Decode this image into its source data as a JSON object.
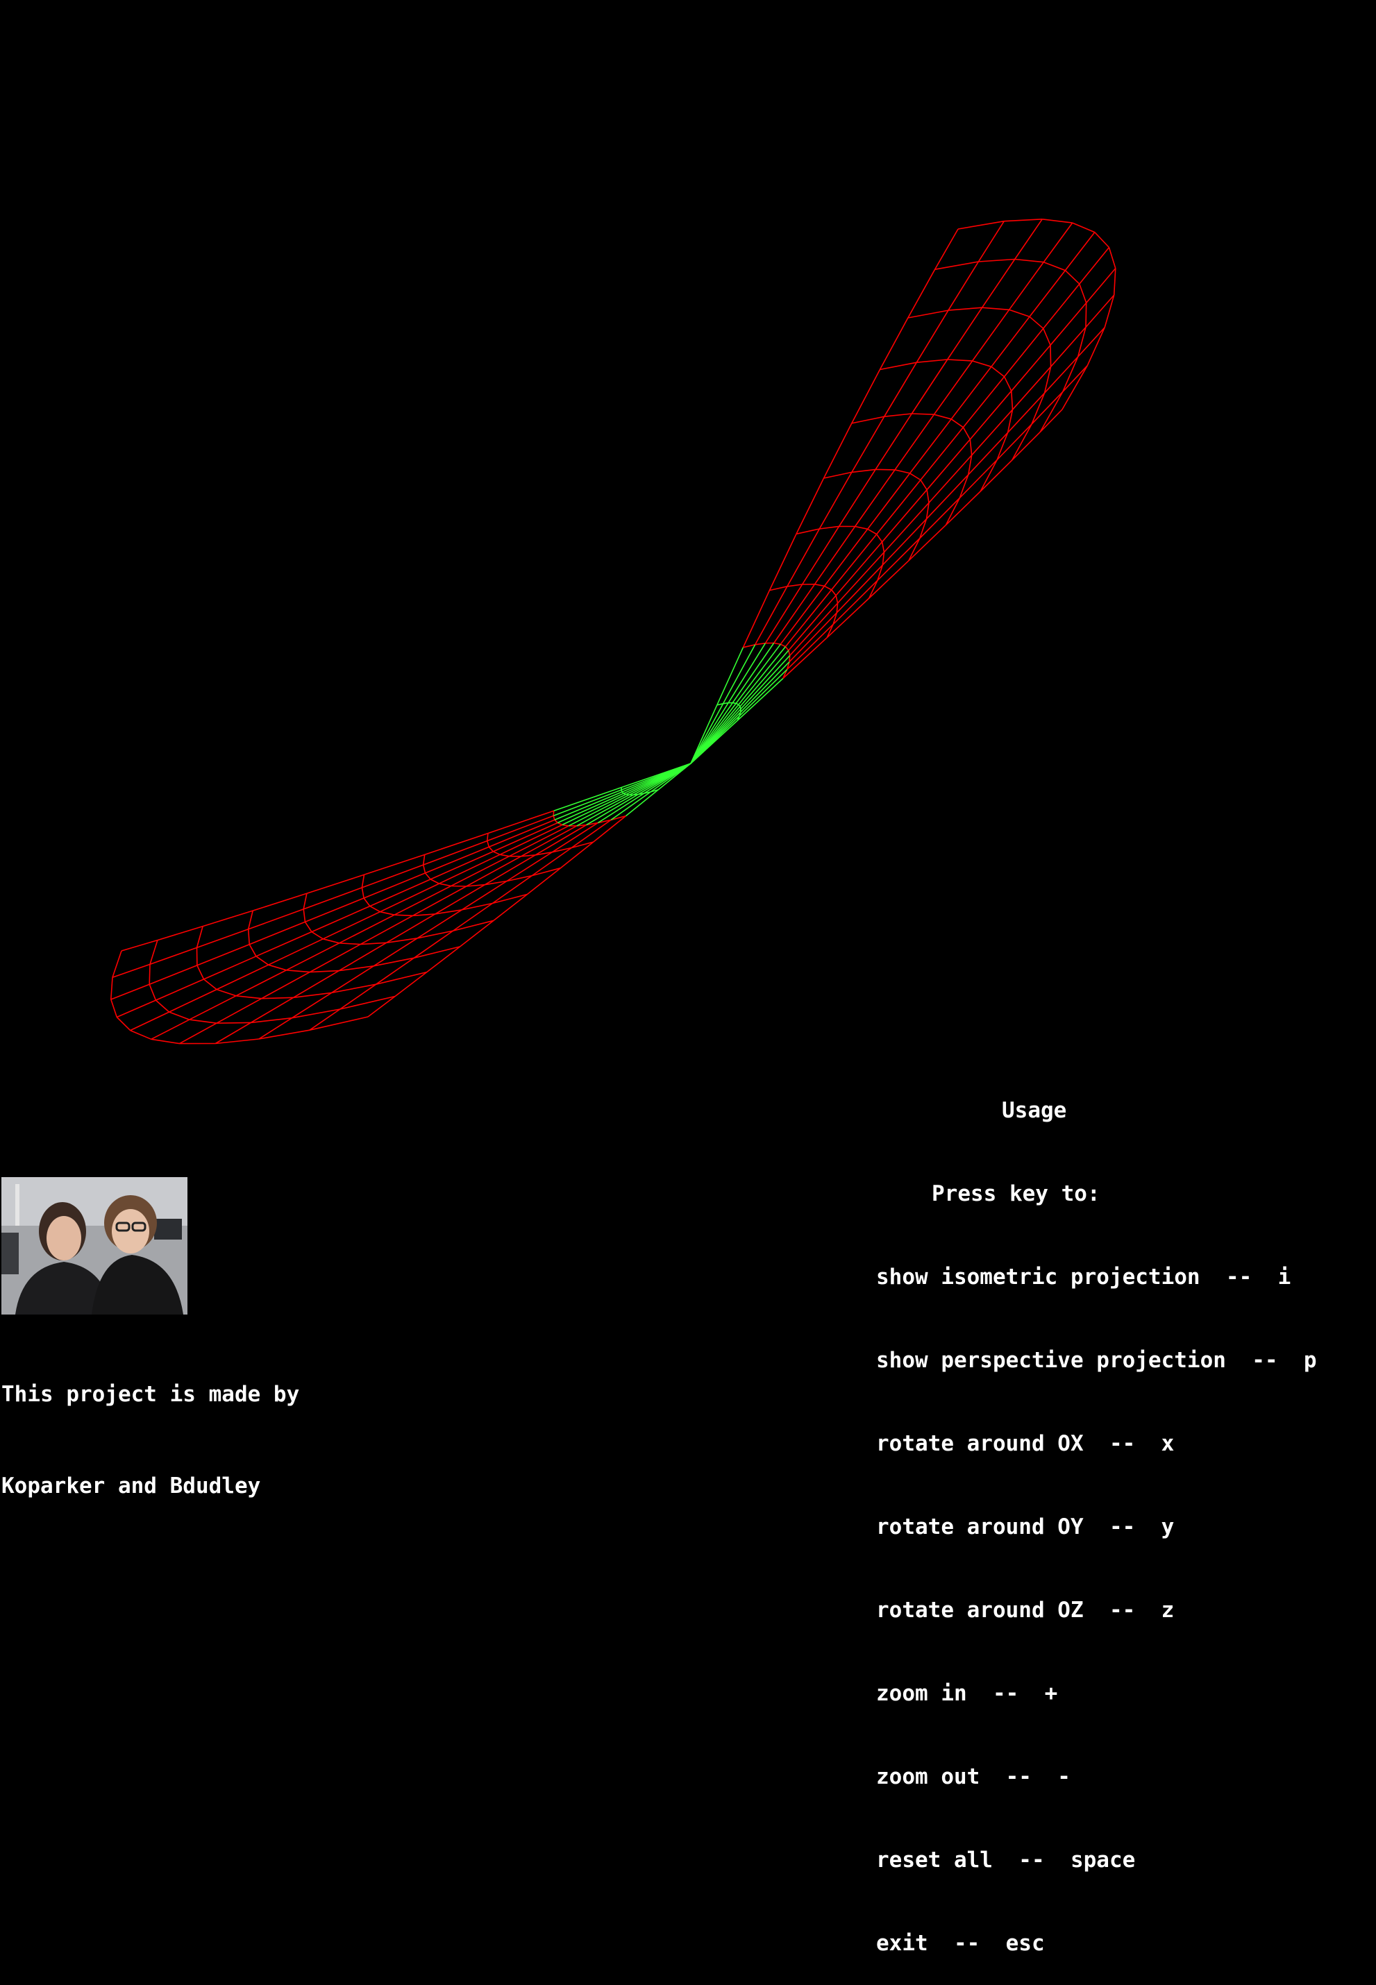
{
  "usage": {
    "title": "Usage",
    "subtitle": "Press key to:",
    "items": [
      {
        "text": "show isometric projection  --  i"
      },
      {
        "text": "show perspective projection  --  p"
      },
      {
        "text": "rotate around OX  --  x"
      },
      {
        "text": "rotate around OY  --  y"
      },
      {
        "text": "rotate around OZ  --  z"
      },
      {
        "text": "zoom in  --  +"
      },
      {
        "text": "zoom out  --  -"
      },
      {
        "text": "reset all  --  space"
      },
      {
        "text": "exit  --  esc"
      }
    ]
  },
  "credits": {
    "line1": "This project is made by",
    "line2": "Koparker and Bdudley"
  },
  "colors": {
    "background": "#000000",
    "wire": "#ff0000",
    "wire_center": "#33ff33",
    "text": "#ffffff"
  }
}
